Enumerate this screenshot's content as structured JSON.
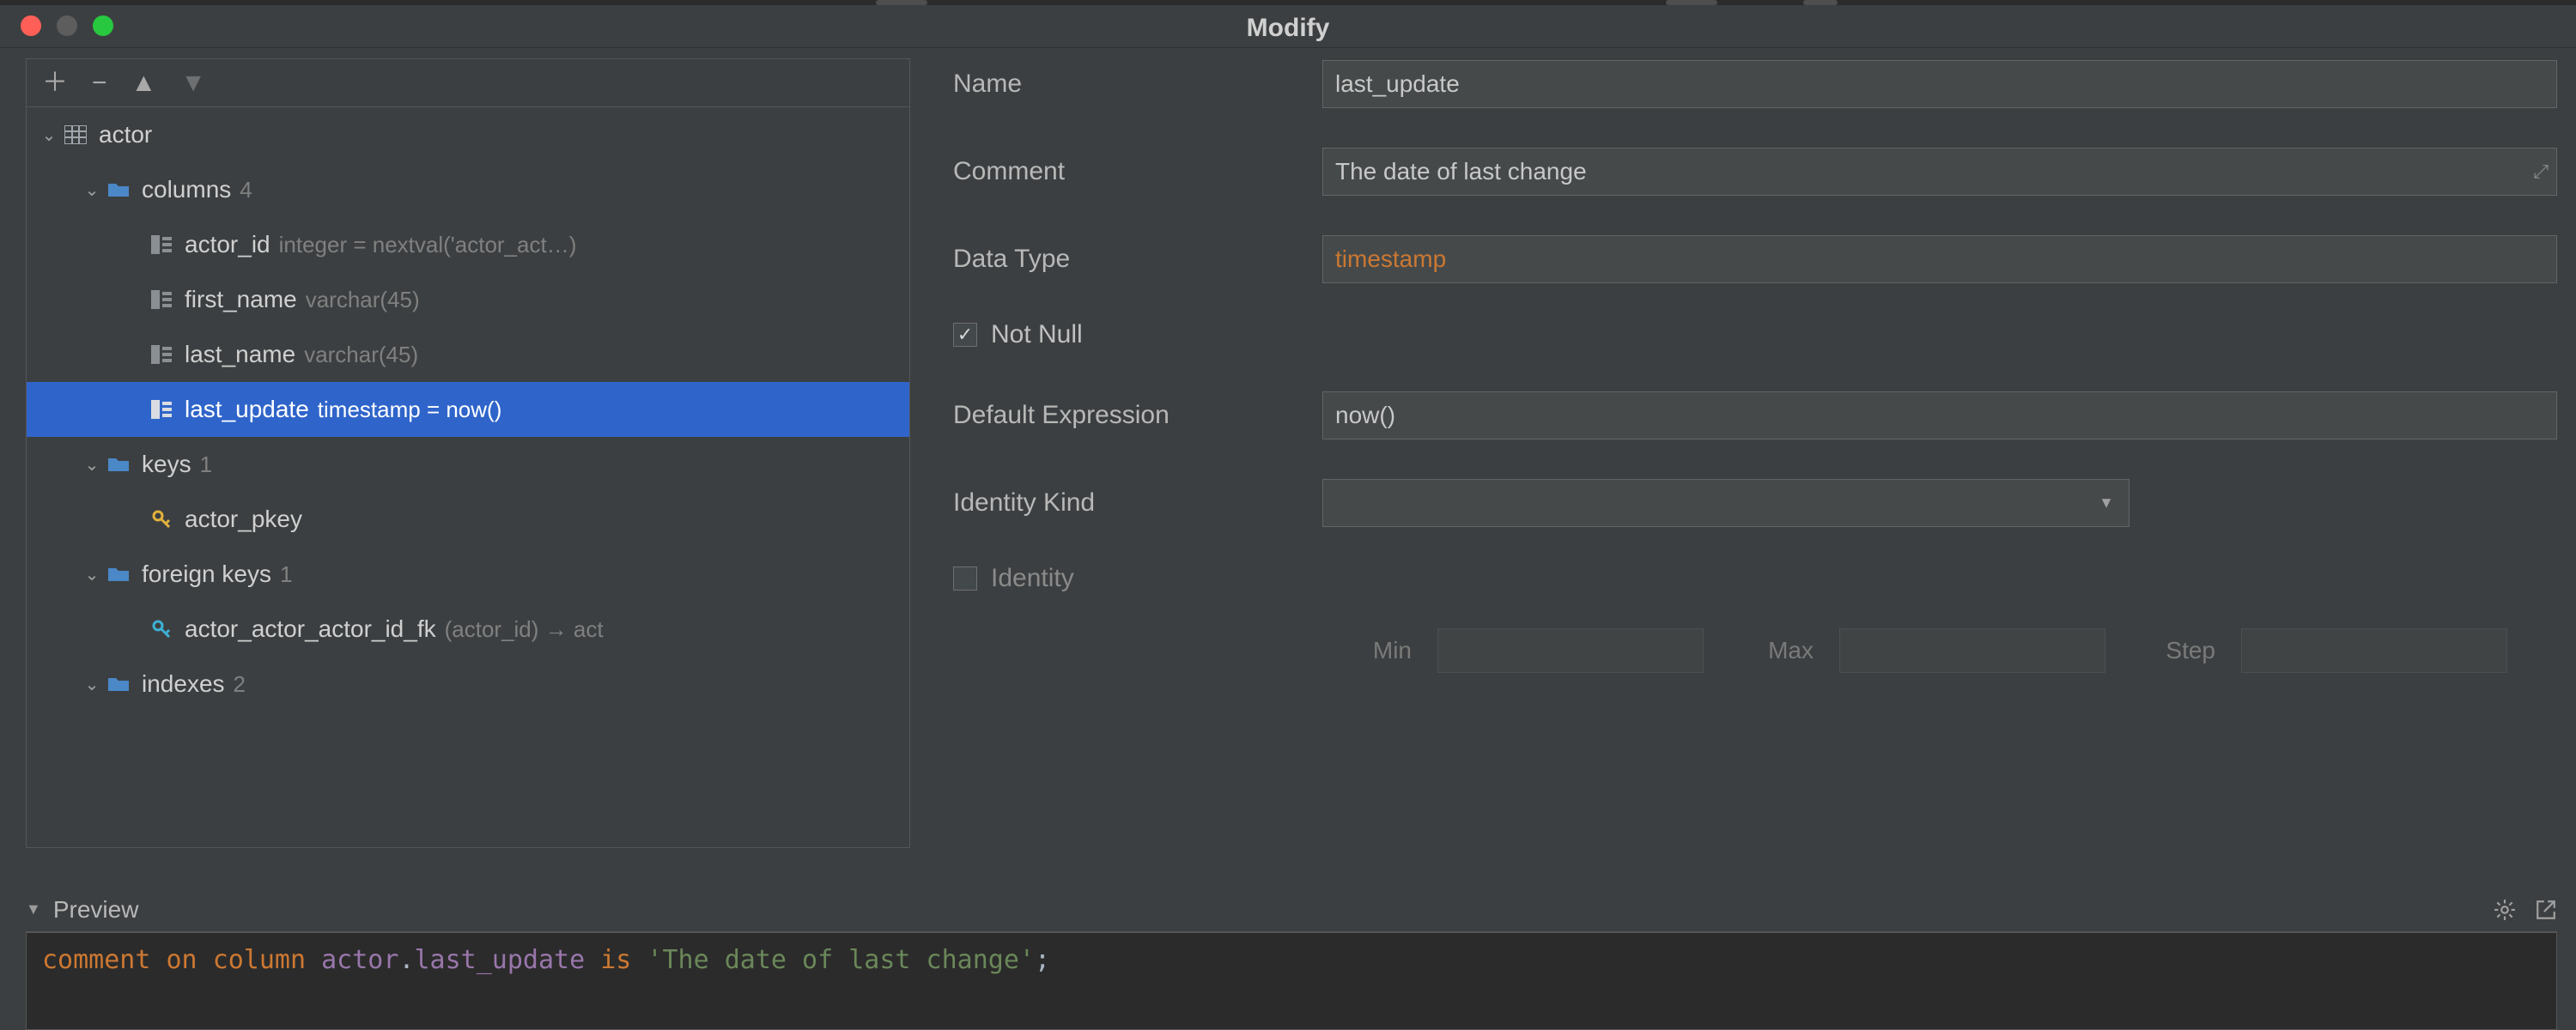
{
  "window": {
    "title": "Modify"
  },
  "tree": {
    "root": {
      "label": "actor",
      "folders": {
        "columns": {
          "label": "columns",
          "count": "4"
        },
        "keys": {
          "label": "keys",
          "count": "1"
        },
        "fkeys": {
          "label": "foreign keys",
          "count": "1"
        },
        "indexes": {
          "label": "indexes",
          "count": "2"
        }
      },
      "columns": [
        {
          "name": "actor_id",
          "type": "integer = nextval('actor_act…)"
        },
        {
          "name": "first_name",
          "type": "varchar(45)"
        },
        {
          "name": "last_name",
          "type": "varchar(45)"
        },
        {
          "name": "last_update",
          "type": "timestamp = now()"
        }
      ],
      "keys": [
        {
          "name": "actor_pkey"
        }
      ],
      "fkeys": [
        {
          "name": "actor_actor_actor_id_fk",
          "detail": "(actor_id) → act"
        }
      ]
    }
  },
  "form": {
    "labels": {
      "name": "Name",
      "comment": "Comment",
      "dataType": "Data Type",
      "notNull": "Not Null",
      "defaultExpr": "Default Expression",
      "identityKind": "Identity Kind",
      "identity": "Identity",
      "min": "Min",
      "max": "Max",
      "step": "Step"
    },
    "values": {
      "name": "last_update",
      "comment": "The date of last change",
      "dataType": "timestamp",
      "notNullChecked": true,
      "defaultExpr": "now()",
      "identityKind": "",
      "identityChecked": false,
      "min": "",
      "max": "",
      "step": ""
    }
  },
  "preview": {
    "label": "Preview",
    "sql": {
      "kw1": "comment",
      "kw2": "on",
      "kw3": "column",
      "table": "actor",
      "dot": ".",
      "column": "last_update",
      "kw4": "is",
      "str": "'The date of last change'",
      "semi": ";"
    }
  }
}
